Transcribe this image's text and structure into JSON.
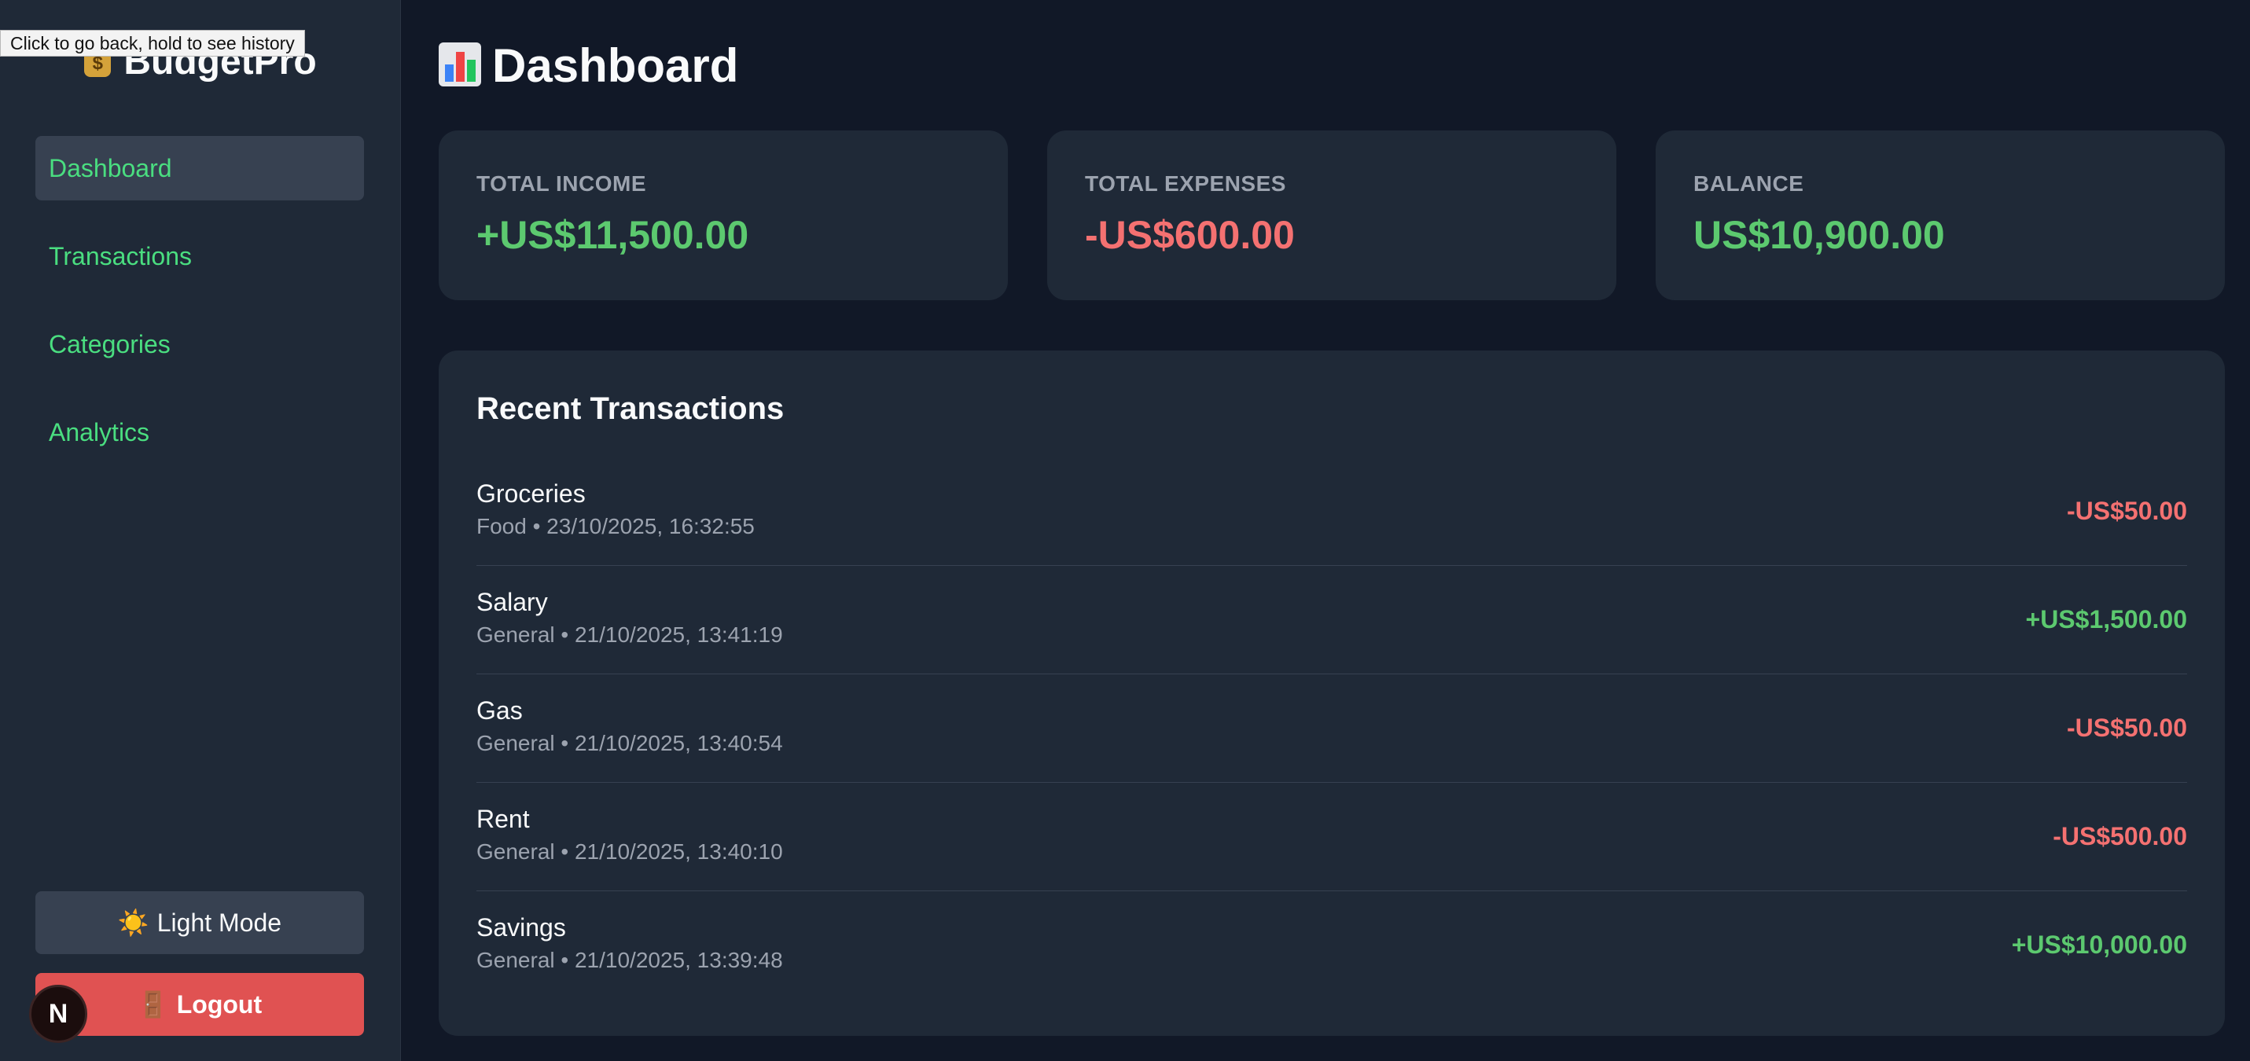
{
  "tooltip": "Click to go back, hold to see history",
  "brand": {
    "name": "BudgetPro",
    "icon": "money-bag-icon"
  },
  "nav": {
    "items": [
      {
        "label": "Dashboard",
        "active": true
      },
      {
        "label": "Transactions",
        "active": false
      },
      {
        "label": "Categories",
        "active": false
      },
      {
        "label": "Analytics",
        "active": false
      }
    ]
  },
  "buttons": {
    "mode_glyph": "☀️",
    "mode_label": "Light Mode",
    "logout_glyph": "🚪",
    "logout_label": "Logout"
  },
  "badge": {
    "letter": "N"
  },
  "page": {
    "title": "Dashboard",
    "icon": "bar-chart-icon"
  },
  "summary": {
    "income": {
      "label": "TOTAL INCOME",
      "value": "+US$11,500.00"
    },
    "expenses": {
      "label": "TOTAL EXPENSES",
      "value": "-US$600.00"
    },
    "balance": {
      "label": "BALANCE",
      "value": "US$10,900.00"
    }
  },
  "recent": {
    "title": "Recent Transactions",
    "items": [
      {
        "name": "Groceries",
        "meta": "Food • 23/10/2025, 16:32:55",
        "amount": "-US$50.00"
      },
      {
        "name": "Salary",
        "meta": "General • 21/10/2025, 13:41:19",
        "amount": "+US$1,500.00"
      },
      {
        "name": "Gas",
        "meta": "General • 21/10/2025, 13:40:54",
        "amount": "-US$50.00"
      },
      {
        "name": "Rent",
        "meta": "General • 21/10/2025, 13:40:10",
        "amount": "-US$500.00"
      },
      {
        "name": "Savings",
        "meta": "General • 21/10/2025, 13:39:48",
        "amount": "+US$10,000.00"
      }
    ]
  },
  "colors": {
    "background": "#111827",
    "sidebar": "#1f2937",
    "card": "#1f2937",
    "income": "#4ade80",
    "expense": "#f47171",
    "logout": "#e05252"
  }
}
